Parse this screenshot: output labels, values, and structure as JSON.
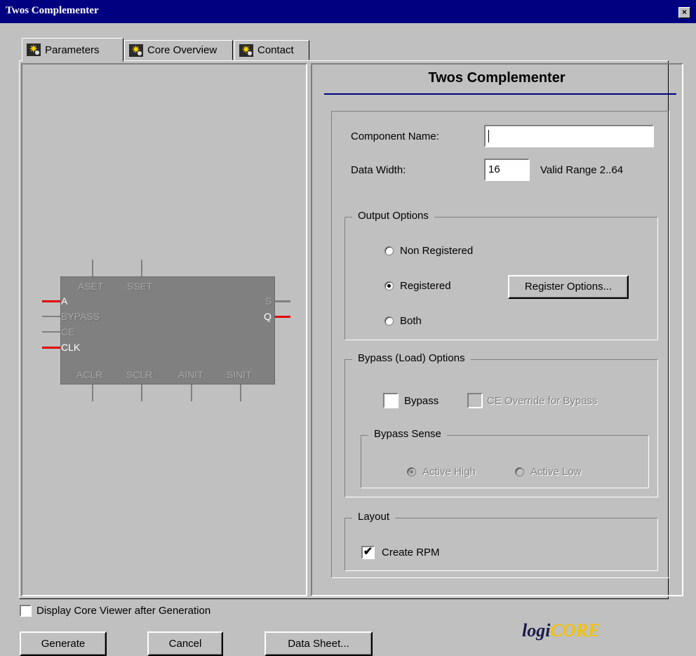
{
  "window": {
    "title": "Twos Complementer",
    "close_glyph": "×"
  },
  "tabs": [
    {
      "label": "Parameters",
      "icon": "xilinx-star-icon"
    },
    {
      "label": "Core Overview",
      "icon": "xilinx-star-icon"
    },
    {
      "label": "Contact",
      "icon": "xilinx-star-icon"
    }
  ],
  "symbol": {
    "top_pins": [
      "ASET",
      "SSET"
    ],
    "left_pins": [
      "A",
      "BYPASS",
      "CE",
      "CLK"
    ],
    "right_pins": [
      "S",
      "Q"
    ],
    "bottom_pins": [
      "ACLR",
      "SCLR",
      "AINIT",
      "SINIT"
    ]
  },
  "form": {
    "heading": "Twos Complementer",
    "component_name_label": "Component Name:",
    "component_name_value": "",
    "data_width_label": "Data Width:",
    "data_width_value": "16",
    "valid_range": "Valid Range 2..64",
    "output_options": {
      "legend": "Output Options",
      "non_registered": "Non Registered",
      "registered": "Registered",
      "both": "Both",
      "selected": "Registered",
      "register_options_button": "Register Options..."
    },
    "bypass_options": {
      "legend": "Bypass (Load) Options",
      "bypass": "Bypass",
      "ce_override": "CE Override for Bypass",
      "sense_legend": "Bypass Sense",
      "active_high": "Active High",
      "active_low": "Active Low"
    },
    "layout": {
      "legend": "Layout",
      "create_rpm": "Create RPM",
      "create_rpm_checked": true
    }
  },
  "footer": {
    "display_viewer": "Display Core Viewer after Generation",
    "generate": "Generate",
    "cancel": "Cancel",
    "data_sheet": "Data Sheet...",
    "logo_text_a": "logi",
    "logo_text_b": "CORE"
  }
}
